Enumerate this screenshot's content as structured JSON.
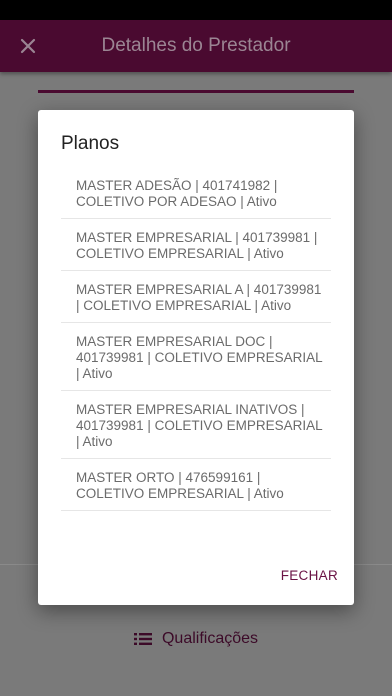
{
  "app_bar": {
    "title": "Detalhes do Prestador",
    "close_icon": "close-icon"
  },
  "background": {
    "qualificacoes_label": "Qualificações",
    "qualificacoes_icon": "list-icon"
  },
  "dialog": {
    "title": "Planos",
    "plans": [
      "MASTER  ADESÃO | 401741982 | COLETIVO POR ADESAO | Ativo",
      "MASTER EMPRESARIAL | 401739981 | COLETIVO EMPRESARIAL | Ativo",
      "MASTER EMPRESARIAL A | 401739981 | COLETIVO EMPRESARIAL | Ativo",
      "MASTER EMPRESARIAL DOC | 401739981 | COLETIVO EMPRESARIAL | Ativo",
      "MASTER EMPRESARIAL INATIVOS | 401739981 | COLETIVO EMPRESARIAL | Ativo",
      "MASTER ORTO | 476599161 | COLETIVO EMPRESARIAL | Ativo"
    ],
    "close_label": "FECHAR"
  },
  "colors": {
    "primary": "#4a0a30",
    "accent": "#6a1244",
    "scrim": "#7a7a7a"
  }
}
